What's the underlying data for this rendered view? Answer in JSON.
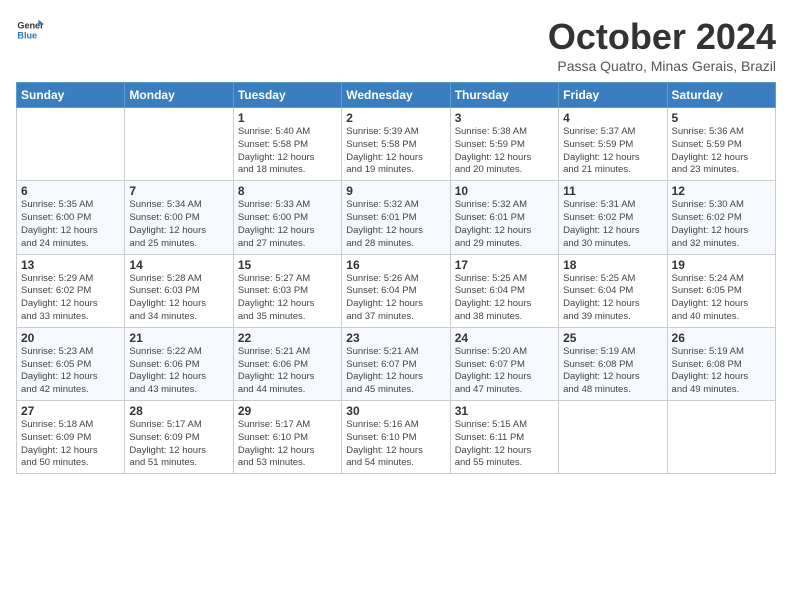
{
  "logo": {
    "line1": "General",
    "line2": "Blue"
  },
  "title": "October 2024",
  "location": "Passa Quatro, Minas Gerais, Brazil",
  "days_header": [
    "Sunday",
    "Monday",
    "Tuesday",
    "Wednesday",
    "Thursday",
    "Friday",
    "Saturday"
  ],
  "weeks": [
    [
      {
        "day": "",
        "info": ""
      },
      {
        "day": "",
        "info": ""
      },
      {
        "day": "1",
        "info": "Sunrise: 5:40 AM\nSunset: 5:58 PM\nDaylight: 12 hours\nand 18 minutes."
      },
      {
        "day": "2",
        "info": "Sunrise: 5:39 AM\nSunset: 5:58 PM\nDaylight: 12 hours\nand 19 minutes."
      },
      {
        "day": "3",
        "info": "Sunrise: 5:38 AM\nSunset: 5:59 PM\nDaylight: 12 hours\nand 20 minutes."
      },
      {
        "day": "4",
        "info": "Sunrise: 5:37 AM\nSunset: 5:59 PM\nDaylight: 12 hours\nand 21 minutes."
      },
      {
        "day": "5",
        "info": "Sunrise: 5:36 AM\nSunset: 5:59 PM\nDaylight: 12 hours\nand 23 minutes."
      }
    ],
    [
      {
        "day": "6",
        "info": "Sunrise: 5:35 AM\nSunset: 6:00 PM\nDaylight: 12 hours\nand 24 minutes."
      },
      {
        "day": "7",
        "info": "Sunrise: 5:34 AM\nSunset: 6:00 PM\nDaylight: 12 hours\nand 25 minutes."
      },
      {
        "day": "8",
        "info": "Sunrise: 5:33 AM\nSunset: 6:00 PM\nDaylight: 12 hours\nand 27 minutes."
      },
      {
        "day": "9",
        "info": "Sunrise: 5:32 AM\nSunset: 6:01 PM\nDaylight: 12 hours\nand 28 minutes."
      },
      {
        "day": "10",
        "info": "Sunrise: 5:32 AM\nSunset: 6:01 PM\nDaylight: 12 hours\nand 29 minutes."
      },
      {
        "day": "11",
        "info": "Sunrise: 5:31 AM\nSunset: 6:02 PM\nDaylight: 12 hours\nand 30 minutes."
      },
      {
        "day": "12",
        "info": "Sunrise: 5:30 AM\nSunset: 6:02 PM\nDaylight: 12 hours\nand 32 minutes."
      }
    ],
    [
      {
        "day": "13",
        "info": "Sunrise: 5:29 AM\nSunset: 6:02 PM\nDaylight: 12 hours\nand 33 minutes."
      },
      {
        "day": "14",
        "info": "Sunrise: 5:28 AM\nSunset: 6:03 PM\nDaylight: 12 hours\nand 34 minutes."
      },
      {
        "day": "15",
        "info": "Sunrise: 5:27 AM\nSunset: 6:03 PM\nDaylight: 12 hours\nand 35 minutes."
      },
      {
        "day": "16",
        "info": "Sunrise: 5:26 AM\nSunset: 6:04 PM\nDaylight: 12 hours\nand 37 minutes."
      },
      {
        "day": "17",
        "info": "Sunrise: 5:25 AM\nSunset: 6:04 PM\nDaylight: 12 hours\nand 38 minutes."
      },
      {
        "day": "18",
        "info": "Sunrise: 5:25 AM\nSunset: 6:04 PM\nDaylight: 12 hours\nand 39 minutes."
      },
      {
        "day": "19",
        "info": "Sunrise: 5:24 AM\nSunset: 6:05 PM\nDaylight: 12 hours\nand 40 minutes."
      }
    ],
    [
      {
        "day": "20",
        "info": "Sunrise: 5:23 AM\nSunset: 6:05 PM\nDaylight: 12 hours\nand 42 minutes."
      },
      {
        "day": "21",
        "info": "Sunrise: 5:22 AM\nSunset: 6:06 PM\nDaylight: 12 hours\nand 43 minutes."
      },
      {
        "day": "22",
        "info": "Sunrise: 5:21 AM\nSunset: 6:06 PM\nDaylight: 12 hours\nand 44 minutes."
      },
      {
        "day": "23",
        "info": "Sunrise: 5:21 AM\nSunset: 6:07 PM\nDaylight: 12 hours\nand 45 minutes."
      },
      {
        "day": "24",
        "info": "Sunrise: 5:20 AM\nSunset: 6:07 PM\nDaylight: 12 hours\nand 47 minutes."
      },
      {
        "day": "25",
        "info": "Sunrise: 5:19 AM\nSunset: 6:08 PM\nDaylight: 12 hours\nand 48 minutes."
      },
      {
        "day": "26",
        "info": "Sunrise: 5:19 AM\nSunset: 6:08 PM\nDaylight: 12 hours\nand 49 minutes."
      }
    ],
    [
      {
        "day": "27",
        "info": "Sunrise: 5:18 AM\nSunset: 6:09 PM\nDaylight: 12 hours\nand 50 minutes."
      },
      {
        "day": "28",
        "info": "Sunrise: 5:17 AM\nSunset: 6:09 PM\nDaylight: 12 hours\nand 51 minutes."
      },
      {
        "day": "29",
        "info": "Sunrise: 5:17 AM\nSunset: 6:10 PM\nDaylight: 12 hours\nand 53 minutes."
      },
      {
        "day": "30",
        "info": "Sunrise: 5:16 AM\nSunset: 6:10 PM\nDaylight: 12 hours\nand 54 minutes."
      },
      {
        "day": "31",
        "info": "Sunrise: 5:15 AM\nSunset: 6:11 PM\nDaylight: 12 hours\nand 55 minutes."
      },
      {
        "day": "",
        "info": ""
      },
      {
        "day": "",
        "info": ""
      }
    ]
  ]
}
